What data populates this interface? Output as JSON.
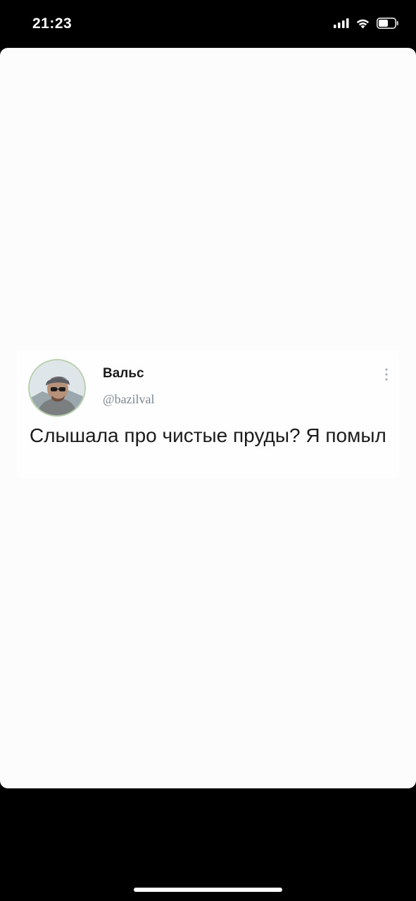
{
  "status_bar": {
    "time": "21:23",
    "icons": [
      "cellular-signal-icon",
      "wifi-icon",
      "battery-icon"
    ]
  },
  "tweet": {
    "author_name": "Вальс",
    "author_handle": "@bazilval",
    "text": "Слышала про чистые пруды? Я помыл",
    "avatar": "avatar-photo",
    "more_icon": "more-vertical-icon"
  },
  "colors": {
    "background": "#000000",
    "card": "#fdfcfd",
    "name_text": "#1b1b1b",
    "handle_text": "#7d8790",
    "avatar_ring": "#b9d0b0"
  }
}
